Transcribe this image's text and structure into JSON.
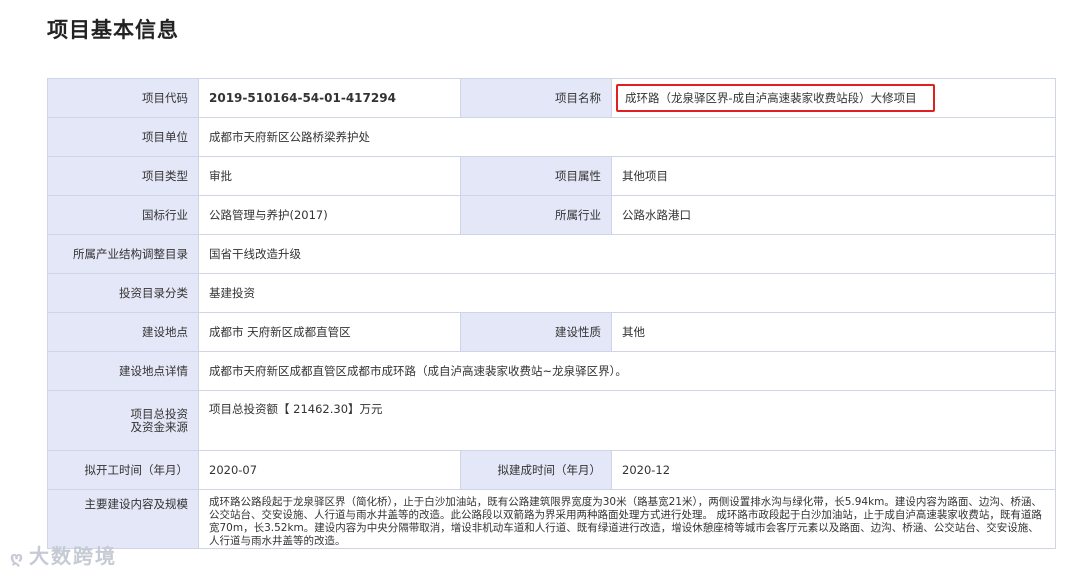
{
  "page": {
    "title": "项目基本信息"
  },
  "rows": {
    "code": {
      "label": "项目代码",
      "value": "2019-510164-54-01-417294"
    },
    "name": {
      "label": "项目名称",
      "value": "成环路（龙泉驿区界-成自泸高速裴家收费站段）大修项目"
    },
    "unit": {
      "label": "项目单位",
      "value": "成都市天府新区公路桥梁养护处"
    },
    "type": {
      "label": "项目类型",
      "value": "审批"
    },
    "attribute": {
      "label": "项目属性",
      "value": "其他项目"
    },
    "national_industry": {
      "label": "国标行业",
      "value": "公路管理与养护(2017)"
    },
    "industry": {
      "label": "所属行业",
      "value": "公路水路港口"
    },
    "catalog": {
      "label": "所属产业结构调整目录",
      "value": "国省干线改造升级"
    },
    "investment_category": {
      "label": "投资目录分类",
      "value": "基建投资"
    },
    "location": {
      "label": "建设地点",
      "value": "成都市 天府新区成都直管区"
    },
    "nature": {
      "label": "建设性质",
      "value": "其他"
    },
    "location_detail": {
      "label": "建设地点详情",
      "value": "成都市天府新区成都直管区成都市成环路（成自泸高速裴家收费站~龙泉驿区界）。"
    },
    "investment": {
      "label_line1": "项目总投资",
      "label_line2": "及资金来源",
      "value": "项目总投资额【 21462.30】万元"
    },
    "start_time": {
      "label": "拟开工时间（年月）",
      "value": "2020-07"
    },
    "end_time": {
      "label": "拟建成时间（年月）",
      "value": "2020-12"
    },
    "scope": {
      "label": "主要建设内容及规模",
      "value": "成环路公路段起于龙泉驿区界（简化桥），止于白沙加油站，既有公路建筑限界宽度为30米（路基宽21米），两侧设置排水沟与绿化带，长5.94km。建设内容为路面、边沟、桥涵、公交站台、交安设施、人行道与雨水井盖等的改造。此公路段以双箭路为界采用两种路面处理方式进行处理。 成环路市政段起于白沙加油站，止于成自泸高速裴家收费站，既有道路宽70m，长3.52km。建设内容为中央分隔带取消，增设非机动车道和人行道、既有绿道进行改造，增设休憩座椅等城市会客厅元素以及路面、边沟、桥涵、公交站台、交安设施、人行道与雨水井盖等的改造。"
    }
  },
  "watermark": {
    "icon": "ღ",
    "text": "大数跨境"
  }
}
